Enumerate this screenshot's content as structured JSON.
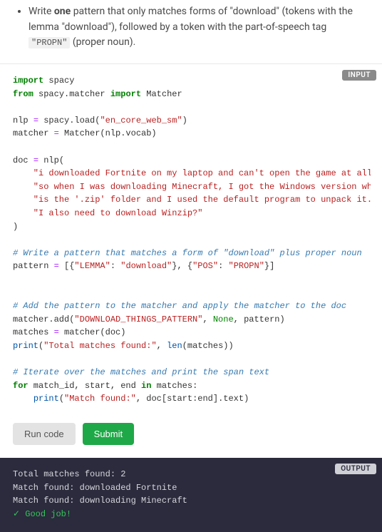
{
  "instructions": {
    "bullet_prefix": "Write ",
    "bullet_bold": "one",
    "bullet_mid": " pattern that only matches forms of \"download\" (tokens with the lemma \"download\"), followed by a token with the part-of-speech tag ",
    "pos_tag": "\"PROPN\"",
    "bullet_suffix": " (proper noun)."
  },
  "badges": {
    "input": "INPUT",
    "output": "OUTPUT"
  },
  "code": {
    "l01_import": "import",
    "l01_spacy": " spacy",
    "l02_from": "from",
    "l02_mod": " spacy.matcher ",
    "l02_import": "import",
    "l02_matcher": " Matcher",
    "l04a": "nlp ",
    "l04eq": "=",
    "l04b": " spacy.load(",
    "l04s": "\"en_core_web_sm\"",
    "l04c": ")",
    "l05": "matcher ",
    "l05eq": "=",
    "l05b": " Matcher(nlp.vocab)",
    "l07a": "doc ",
    "l07eq": "=",
    "l07b": " nlp(",
    "l08": "    \"i downloaded Fortnite on my laptop and can't open the game at all. Help? \"",
    "l09": "    \"so when I was downloading Minecraft, I got the Windows version where it \"",
    "l10": "    \"is the '.zip' folder and I used the default program to unpack it... do \"",
    "l11": "    \"I also need to download Winzip?\"",
    "l12": ")",
    "l14_cm": "# Write a pattern that matches a form of \"download\" plus proper noun",
    "l15a": "pattern ",
    "l15eq": "=",
    "l15b": " [{",
    "l15k1": "\"LEMMA\"",
    "l15c": ": ",
    "l15v1": "\"download\"",
    "l15d": "}, {",
    "l15k2": "\"POS\"",
    "l15e": ": ",
    "l15v2": "\"PROPN\"",
    "l15f": "}]",
    "l18_cm": "# Add the pattern to the matcher and apply the matcher to the doc",
    "l19a": "matcher.add(",
    "l19s": "\"DOWNLOAD_THINGS_PATTERN\"",
    "l19b": ", ",
    "l19none": "None",
    "l19c": ", pattern)",
    "l20": "matches ",
    "l20eq": "=",
    "l20b": " matcher(doc)",
    "l21p": "print",
    "l21a": "(",
    "l21s": "\"Total matches found:\"",
    "l21b": ", ",
    "l21len": "len",
    "l21c": "(matches))",
    "l23_cm": "# Iterate over the matches and print the span text",
    "l24_for": "for",
    "l24a": " match_id, start, end ",
    "l24_in": "in",
    "l24b": " matches:",
    "l25a": "    ",
    "l25p": "print",
    "l25b": "(",
    "l25s": "\"Match found:\"",
    "l25c": ", doc[start:end].text)"
  },
  "actions": {
    "run": "Run code",
    "submit": "Submit"
  },
  "output": {
    "line1": "Total matches found: 2",
    "line2": "Match found: downloaded Fortnite",
    "line3": "Match found: downloading Minecraft",
    "good": "✓ Good job!"
  }
}
